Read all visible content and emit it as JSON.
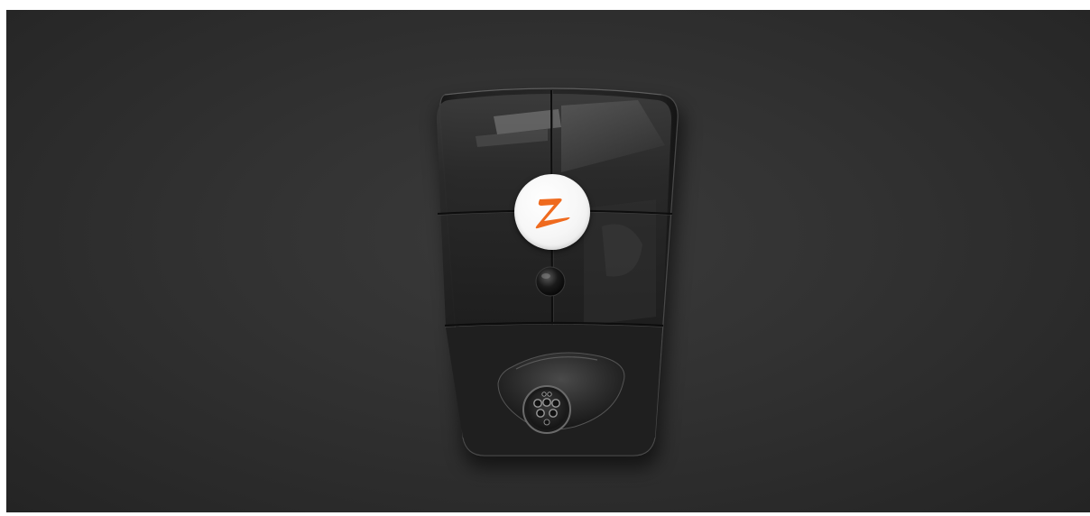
{
  "scene": {
    "subject": "wall-mounted-ev-charger",
    "background_color": "#2f2f2f",
    "device_body_color": "#1c1c1c",
    "logo": {
      "icon": "z-brand-logo-icon",
      "badge_color": "#ffffff",
      "mark_color": "#ef6a1e"
    }
  }
}
